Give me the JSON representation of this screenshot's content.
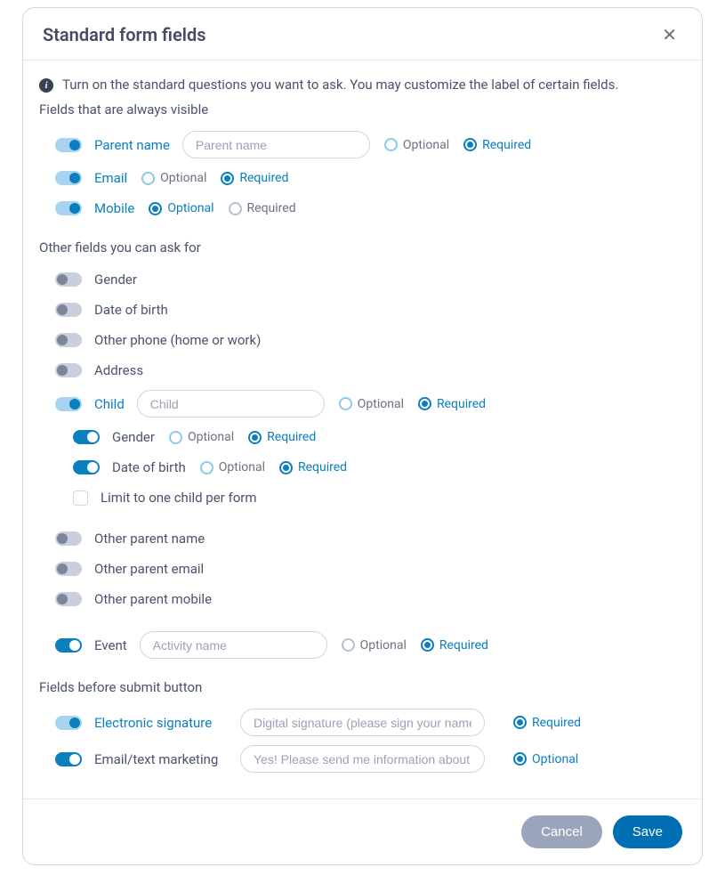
{
  "title": "Standard form fields",
  "info_text": "Turn on the standard questions you want to ask. You may customize the label of certain fields.",
  "sections": {
    "always_visible": "Fields that are always visible",
    "other_fields": "Other fields you can ask for",
    "before_submit": "Fields before submit button"
  },
  "labels": {
    "optional": "Optional",
    "required": "Required"
  },
  "fields": {
    "parent_name": {
      "label": "Parent name",
      "placeholder": "Parent name"
    },
    "email": {
      "label": "Email"
    },
    "mobile": {
      "label": "Mobile"
    },
    "gender": {
      "label": "Gender"
    },
    "dob": {
      "label": "Date of birth"
    },
    "other_phone": {
      "label": "Other phone (home or work)"
    },
    "address": {
      "label": "Address"
    },
    "child": {
      "label": "Child",
      "placeholder": "Child"
    },
    "child_gender": {
      "label": "Gender"
    },
    "child_dob": {
      "label": "Date of birth"
    },
    "limit_child": {
      "label": "Limit to one child per form"
    },
    "other_parent_name": {
      "label": "Other parent name"
    },
    "other_parent_email": {
      "label": "Other parent email"
    },
    "other_parent_mobile": {
      "label": "Other parent mobile"
    },
    "event": {
      "label": "Event",
      "placeholder": "Activity name"
    },
    "esign": {
      "label": "Electronic signature",
      "placeholder": "Digital signature (please sign your name in the box)"
    },
    "marketing": {
      "label": "Email/text marketing",
      "placeholder": "Yes! Please send me information about your services"
    }
  },
  "footer": {
    "cancel": "Cancel",
    "save": "Save"
  }
}
